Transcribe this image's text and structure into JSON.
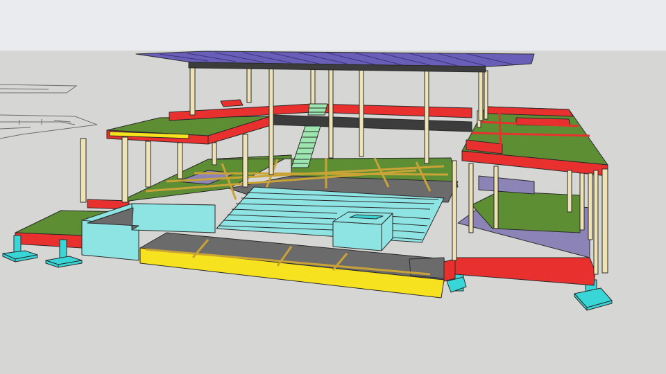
{
  "viewport": {
    "sky_color": "#e9ebee",
    "ground_color": "#d6d6d4",
    "edge_color": "#2a2a2a"
  },
  "model": {
    "materials": {
      "roof": "#6a5fb8",
      "beam_red": "#e8312f",
      "beam_dark": "#3c3c3c",
      "slab_green": "#5e8e34",
      "slab_purple": "#8c84b6",
      "slab_gray": "#6b6b6b",
      "column": "#efe3b6",
      "footing_cyan": "#38d6d6",
      "wall_cyan": "#8ee3e3",
      "stair_green": "#9ee6b0",
      "edge_yellow": "#f7e21f",
      "grid_line": "#c9a336"
    },
    "components": [
      "roof",
      "upper-floor-slab",
      "stair",
      "ground-floor-slab",
      "steps",
      "retaining-wall",
      "footings",
      "columns",
      "right-wing"
    ]
  },
  "sketch": {
    "lines": [
      "site-plan-sketch-1",
      "site-plan-sketch-2"
    ]
  }
}
